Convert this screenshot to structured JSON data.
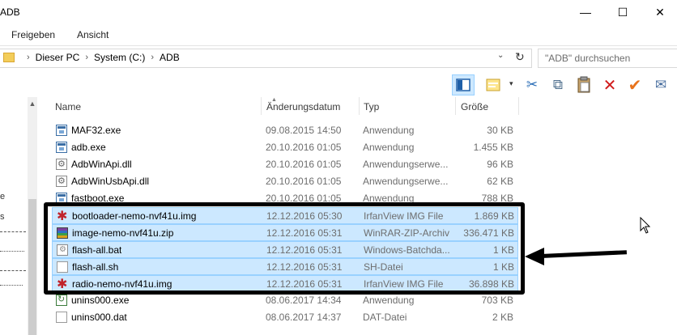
{
  "window": {
    "title": "ADB",
    "buttons": {
      "minimize": "—",
      "maximize": "☐",
      "close": "✕"
    }
  },
  "ribbon": {
    "tabs": [
      "Freigeben",
      "Ansicht"
    ]
  },
  "address": {
    "crumbs": [
      "Dieser PC",
      "System (C:)",
      "ADB"
    ],
    "separator": "›",
    "chevron": "⌄",
    "refresh": "↻"
  },
  "search": {
    "placeholder": "\"ADB\" durchsuchen"
  },
  "toolbar": {
    "icons": [
      "preview-pane-icon",
      "properties-icon",
      "cut-icon",
      "copy-icon",
      "paste-icon",
      "delete-icon",
      "checkmark-icon",
      "email-icon"
    ],
    "glyphs": {
      "cut": "✂",
      "copy": "⧉",
      "paste": "📋",
      "delete": "✕",
      "check": "✔",
      "mail": "✉",
      "caret": "▾"
    }
  },
  "nav_fragments": [
    "e",
    "s"
  ],
  "columns": {
    "name": "Name",
    "date": "Änderungsdatum",
    "type": "Typ",
    "size": "Größe",
    "sort_arrow": "▲"
  },
  "files": [
    {
      "name": "MAF32.exe",
      "date": "09.08.2015 14:50",
      "type": "Anwendung",
      "size": "30 KB",
      "icon": "exe",
      "selected": false
    },
    {
      "name": "adb.exe",
      "date": "20.10.2016 01:05",
      "type": "Anwendung",
      "size": "1.455 KB",
      "icon": "exe",
      "selected": false
    },
    {
      "name": "AdbWinApi.dll",
      "date": "20.10.2016 01:05",
      "type": "Anwendungserwe...",
      "size": "96 KB",
      "icon": "dll",
      "selected": false
    },
    {
      "name": "AdbWinUsbApi.dll",
      "date": "20.10.2016 01:05",
      "type": "Anwendungserwe...",
      "size": "62 KB",
      "icon": "dll",
      "selected": false
    },
    {
      "name": "fastboot.exe",
      "date": "20.10.2016 01:05",
      "type": "Anwendung",
      "size": "788 KB",
      "icon": "exe",
      "selected": false
    },
    {
      "name": "bootloader-nemo-nvf41u.img",
      "date": "12.12.2016 05:30",
      "type": "IrfanView IMG File",
      "size": "1.869 KB",
      "icon": "img",
      "selected": true
    },
    {
      "name": "image-nemo-nvf41u.zip",
      "date": "12.12.2016 05:31",
      "type": "WinRAR-ZIP-Archiv",
      "size": "336.471 KB",
      "icon": "zip",
      "selected": true
    },
    {
      "name": "flash-all.bat",
      "date": "12.12.2016 05:31",
      "type": "Windows-Batchda...",
      "size": "1 KB",
      "icon": "bat",
      "selected": true
    },
    {
      "name": "flash-all.sh",
      "date": "12.12.2016 05:31",
      "type": "SH-Datei",
      "size": "1 KB",
      "icon": "sh",
      "selected": true
    },
    {
      "name": "radio-nemo-nvf41u.img",
      "date": "12.12.2016 05:31",
      "type": "IrfanView IMG File",
      "size": "36.898 KB",
      "icon": "img",
      "selected": true
    },
    {
      "name": "unins000.exe",
      "date": "08.06.2017 14:34",
      "type": "Anwendung",
      "size": "703 KB",
      "icon": "unins",
      "selected": false
    },
    {
      "name": "unins000.dat",
      "date": "08.06.2017 14:37",
      "type": "DAT-Datei",
      "size": "2 KB",
      "icon": "dat",
      "selected": false
    }
  ],
  "annotation": {
    "color": "#000000"
  },
  "colors": {
    "selection_bg": "#cce8ff",
    "selection_border": "#99d1ff",
    "delete_red": "#d11c1c",
    "check_orange": "#e8731c"
  }
}
